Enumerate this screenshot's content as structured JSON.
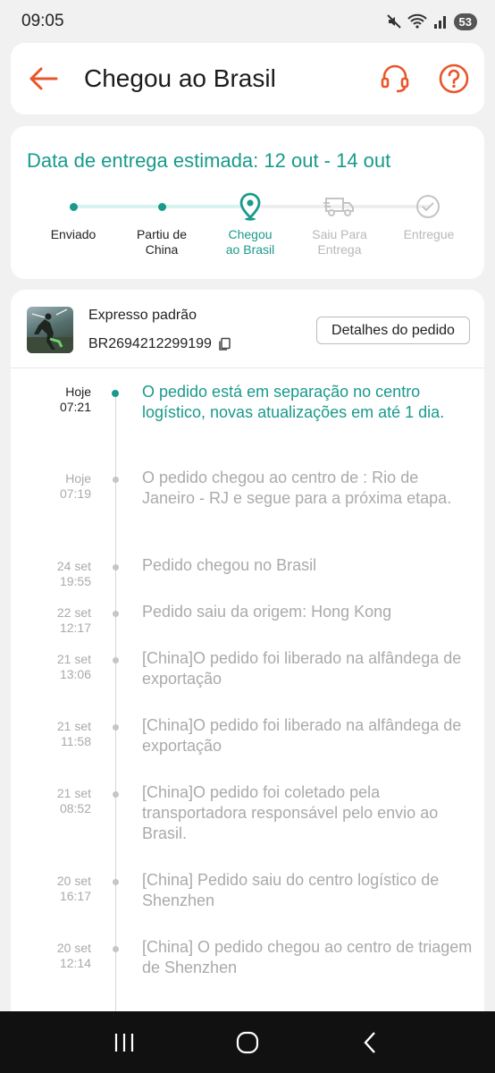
{
  "status_bar": {
    "time": "09:05",
    "battery": "53"
  },
  "header": {
    "title": "Chegou ao Brasil"
  },
  "delivery": {
    "eta": "Data de entrega estimada: 12 out - 14 out",
    "steps": [
      {
        "label": "Enviado",
        "state": "done"
      },
      {
        "label": "Partiu de China",
        "state": "done"
      },
      {
        "label": "Chegou ao Brasil",
        "state": "current"
      },
      {
        "label": "Saiu Para Entrega",
        "state": "pending"
      },
      {
        "label": "Entregue",
        "state": "pending"
      }
    ]
  },
  "shipment": {
    "method": "Expresso padrão",
    "tracking_number": "BR2694212299199",
    "details_button": "Detalhes do pedido"
  },
  "events": [
    {
      "day": "Hoje",
      "time": "07:21",
      "text": "O pedido está em separação no centro logístico, novas atualizações em até 1 dia.",
      "active": true
    },
    {
      "day": "Hoje",
      "time": "07:19",
      "text": "O pedido chegou ao centro de : Rio de Janeiro - RJ e segue para a próxima etapa."
    },
    {
      "day": "24 set",
      "time": "19:55",
      "text": "Pedido chegou no Brasil"
    },
    {
      "day": "22 set",
      "time": "12:17",
      "text": "Pedido saiu da origem: Hong Kong"
    },
    {
      "day": "21 set",
      "time": "13:06",
      "text": "[China]O pedido foi liberado na alfândega de exportação"
    },
    {
      "day": "21 set",
      "time": "11:58",
      "text": "[China]O pedido foi liberado na alfândega de exportação"
    },
    {
      "day": "21 set",
      "time": "08:52",
      "text": "[China]O pedido foi coletado pela transportadora responsável pelo envio ao Brasil."
    },
    {
      "day": "20 set",
      "time": "16:17",
      "text": "[China] Pedido saiu do centro logístico de Shenzhen"
    },
    {
      "day": "20 set",
      "time": "12:14",
      "text": "[China] O pedido chegou ao centro de triagem de Shenzhen"
    }
  ],
  "colors": {
    "accent": "#199a8c",
    "orange": "#e8562a",
    "muted": "#aaaaaa"
  },
  "icons": [
    "back-arrow-icon",
    "support-headset-icon",
    "help-icon",
    "copy-icon",
    "location-pin-icon",
    "delivery-truck-icon",
    "check-circle-icon",
    "mute-icon",
    "wifi-icon",
    "signal-icon"
  ]
}
